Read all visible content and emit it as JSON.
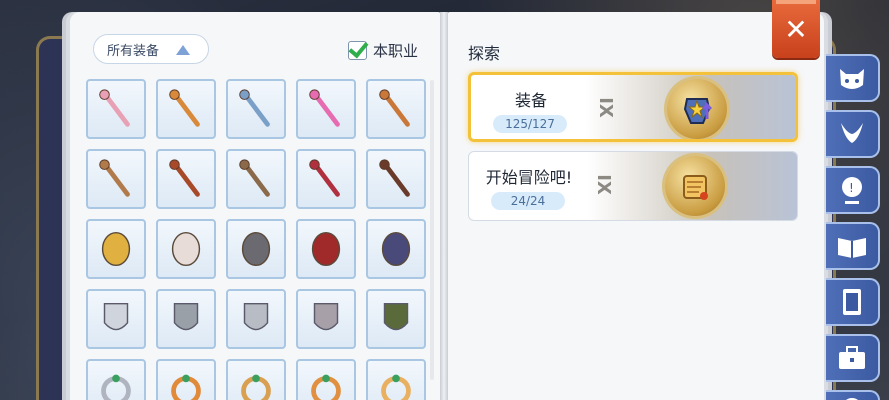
{
  "filter": {
    "label": "所有装备",
    "icon": "triangle-up-icon"
  },
  "job_filter": {
    "label": "本职业",
    "checked": true
  },
  "explore": {
    "title": "探索",
    "categories": [
      {
        "name": "装备",
        "count": "125/127",
        "selected": true,
        "roman": "IX",
        "icon": "armor-medal-icon"
      },
      {
        "name": "开始冒险吧!",
        "count": "24/24",
        "selected": false,
        "roman": "IX",
        "icon": "scroll-medal-icon"
      }
    ]
  },
  "close_icon": "✕",
  "equipment_grid": [
    {
      "icon": "staff-pink-icon"
    },
    {
      "icon": "staff-orange-icon"
    },
    {
      "icon": "staff-star-icon"
    },
    {
      "icon": "wand-pink-icon"
    },
    {
      "icon": "paw-staff-icon"
    },
    {
      "icon": "shovel-icon"
    },
    {
      "icon": "cross-staff-icon"
    },
    {
      "icon": "hook-staff-icon"
    },
    {
      "icon": "red-gem-staff-icon"
    },
    {
      "icon": "walking-stick-icon"
    },
    {
      "icon": "feather-icon"
    },
    {
      "icon": "pearl-shield-icon"
    },
    {
      "icon": "round-stone-icon"
    },
    {
      "icon": "red-book-icon"
    },
    {
      "icon": "blue-book-icon"
    },
    {
      "icon": "crystal-shield-icon"
    },
    {
      "icon": "steel-shield-icon"
    },
    {
      "icon": "silver-statue-icon"
    },
    {
      "icon": "knight-statue-icon"
    },
    {
      "icon": "beast-claw-icon"
    },
    {
      "icon": "gauntlet-icon"
    },
    {
      "icon": "bracelet-orange-icon"
    },
    {
      "icon": "ring-gold-icon"
    },
    {
      "icon": "ring-orange-icon"
    },
    {
      "icon": "bracelet-green-icon"
    }
  ],
  "side_tabs": [
    {
      "icon": "cat-face-icon"
    },
    {
      "icon": "horns-icon"
    },
    {
      "icon": "speech-bubble-icon"
    },
    {
      "icon": "open-book-icon"
    },
    {
      "icon": "card-icon"
    },
    {
      "icon": "toolbox-icon"
    },
    {
      "icon": "compass-icon"
    }
  ],
  "colors": {
    "accent": "#f3c23a",
    "tab": "#4f6fb8",
    "close": "#d9532a"
  }
}
